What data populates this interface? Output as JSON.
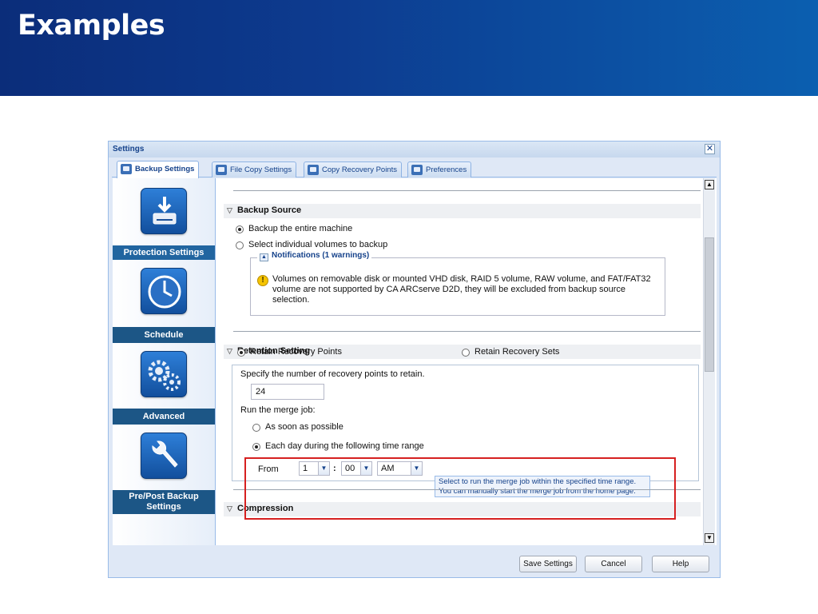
{
  "slide": {
    "title": "Examples"
  },
  "dialog": {
    "title": "Settings",
    "close_glyph": "✕",
    "tabs": [
      {
        "label": "Backup Settings",
        "icon": "backup-icon"
      },
      {
        "label": "File Copy Settings",
        "icon": "file-copy-icon"
      },
      {
        "label": "Copy Recovery Points",
        "icon": "copy-recovery-icon"
      },
      {
        "label": "Preferences",
        "icon": "preferences-icon"
      }
    ],
    "nav": [
      {
        "label": "Protection Settings",
        "icon": "download-drive-icon"
      },
      {
        "label": "Schedule",
        "icon": "clock-icon"
      },
      {
        "label": "Advanced",
        "icon": "gears-icon"
      },
      {
        "label": "Pre/Post Backup Settings",
        "icon": "wrench-icon"
      }
    ],
    "backup_source": {
      "header": "Backup Source",
      "option_entire": "Backup the entire machine",
      "option_volumes": "Select individual volumes to backup",
      "selected": "entire",
      "notifications_title": "Notifications (1 warnings)",
      "warning_text": "Volumes on removable disk or mounted VHD disk, RAID 5 volume, RAW volume, and FAT/FAT32 volume are not supported by CA ARCserve D2D, they will be excluded from backup source selection."
    },
    "retention": {
      "header": "Retention Setting",
      "option_points": "Retain Recovery Points",
      "option_sets": "Retain Recovery Sets",
      "selected": "points",
      "points_prompt": "Specify the number of recovery points to retain.",
      "points_value": "24",
      "merge_prompt": "Run the merge job:",
      "merge_asap": "As soon as possible",
      "merge_daily": "Each day during the following time range",
      "merge_selected": "daily",
      "from_label": "From",
      "from_hour": "1",
      "colon": ":",
      "from_minute": "00",
      "from_ampm": "AM",
      "tooltip_line1": "Select to run the merge job within the specified time range.",
      "tooltip_line2": "You can manually start the merge job from the home page."
    },
    "compression": {
      "header": "Compression"
    },
    "buttons": {
      "save": "Save Settings",
      "cancel": "Cancel",
      "help": "Help"
    },
    "colors": {
      "accent": "#15428b",
      "highlight": "#d62020",
      "slide_header": "#0b3f96"
    }
  }
}
